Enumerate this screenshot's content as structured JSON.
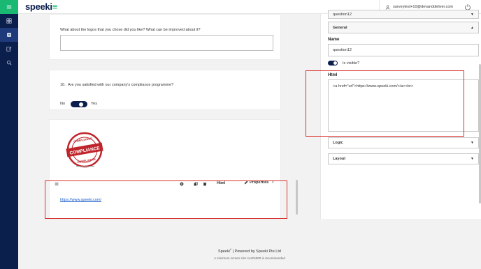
{
  "header": {
    "logo_main": "speeki",
    "user_email": "surveytest+10@devanddeliver.com"
  },
  "sidebar": {
    "items": [
      {
        "icon": "menu-icon"
      },
      {
        "icon": "grid-icon"
      },
      {
        "icon": "layers-icon"
      },
      {
        "icon": "edit-icon"
      },
      {
        "icon": "search-icon"
      }
    ]
  },
  "survey": {
    "q9_text": "What about the logos that you chose did you like? What can be improved about it?",
    "q10_number": "10.",
    "q10_text": "Are you satisfied with our company's compliance programme?",
    "q10_no": "No",
    "q10_yes": "Yes",
    "stamp": {
      "top": "COMPLIANCE",
      "middle": "COMPLIANCE",
      "bottom": "COMPLIANCE"
    },
    "html_toolbar_title": "Html",
    "html_toolbar_properties": "Properties",
    "html_link": "https://www.speeki.com/"
  },
  "properties_panel": {
    "top_select_value": "question12",
    "group_general": "General",
    "name_label": "Name",
    "name_value": "question12",
    "visible_label": "Is visible?",
    "html_label": "Html",
    "html_value": "<a href=\"url\">https://www.speeki.com/</a><br>",
    "logic_label": "Logic",
    "layout_label": "Layout"
  },
  "footer": {
    "brand": "Speeki",
    "powered": "| Powered by Speeki Pte Ltd",
    "note": "A minimum screen size 1440x900 is recommended"
  },
  "colors": {
    "navy": "#0b1f4d",
    "green": "#19b873",
    "highlight": "#d9302c",
    "link": "#1a5cc8"
  }
}
